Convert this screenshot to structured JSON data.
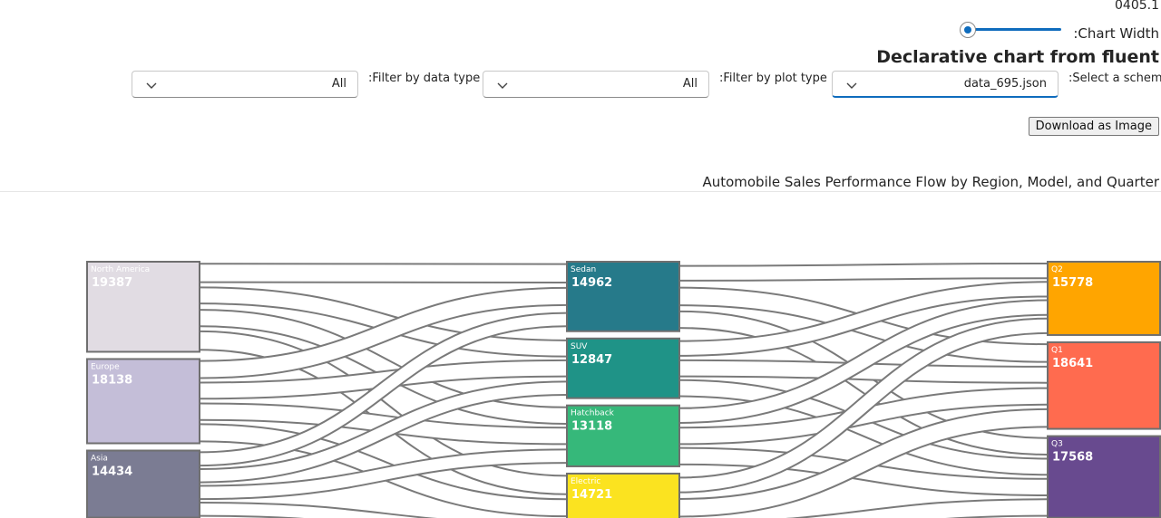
{
  "header": {
    "version": "0405.1",
    "chart_width_label": ":Chart Width",
    "chart_width_value": 0.05,
    "heading": "Declarative chart from fluent"
  },
  "filters": {
    "data_type_label": ":Filter by data type",
    "data_type_value": "All",
    "plot_type_label": ":Filter by plot type",
    "plot_type_value": "All",
    "schema_label": ":Select a schema",
    "schema_value": "data_695.json"
  },
  "download_label": "Download as Image",
  "chart_data": {
    "type": "sankey",
    "title": "Automobile Sales Performance Flow by Region, Model, and Quarter",
    "nodes": [
      {
        "name": "North America",
        "value": 19387,
        "color": "#e1dce3",
        "column": 0
      },
      {
        "name": "Europe",
        "value": 18138,
        "color": "#c4bed8",
        "column": 0
      },
      {
        "name": "Asia",
        "value": 14434,
        "color": "#7b7c93",
        "column": 0
      },
      {
        "name": "Sedan",
        "value": 14962,
        "color": "#267a8a",
        "column": 1
      },
      {
        "name": "SUV",
        "value": 12847,
        "color": "#1f9387",
        "column": 1
      },
      {
        "name": "Hatchback",
        "value": 13118,
        "color": "#36b87a",
        "column": 1
      },
      {
        "name": "Electric",
        "value": 14721,
        "color": "#fbe320",
        "column": 1
      },
      {
        "name": "Q2",
        "value": 15778,
        "color": "#ffa500",
        "column": 2
      },
      {
        "name": "Q1",
        "value": 18641,
        "color": "#ff6b4f",
        "column": 2
      },
      {
        "name": "Q3",
        "value": 17568,
        "color": "#684a8f",
        "column": 2
      }
    ],
    "links": [
      {
        "source": "North America",
        "target": "Sedan"
      },
      {
        "source": "North America",
        "target": "SUV"
      },
      {
        "source": "North America",
        "target": "Hatchback"
      },
      {
        "source": "North America",
        "target": "Electric"
      },
      {
        "source": "Europe",
        "target": "Sedan"
      },
      {
        "source": "Europe",
        "target": "SUV"
      },
      {
        "source": "Europe",
        "target": "Hatchback"
      },
      {
        "source": "Europe",
        "target": "Electric"
      },
      {
        "source": "Asia",
        "target": "Sedan"
      },
      {
        "source": "Asia",
        "target": "SUV"
      },
      {
        "source": "Asia",
        "target": "Hatchback"
      },
      {
        "source": "Asia",
        "target": "Electric"
      },
      {
        "source": "Sedan",
        "target": "Q2"
      },
      {
        "source": "Sedan",
        "target": "Q1"
      },
      {
        "source": "Sedan",
        "target": "Q3"
      },
      {
        "source": "SUV",
        "target": "Q2"
      },
      {
        "source": "SUV",
        "target": "Q1"
      },
      {
        "source": "SUV",
        "target": "Q3"
      },
      {
        "source": "Hatchback",
        "target": "Q2"
      },
      {
        "source": "Hatchback",
        "target": "Q1"
      },
      {
        "source": "Hatchback",
        "target": "Q3"
      },
      {
        "source": "Electric",
        "target": "Q2"
      },
      {
        "source": "Electric",
        "target": "Q1"
      },
      {
        "source": "Electric",
        "target": "Q3"
      }
    ]
  }
}
